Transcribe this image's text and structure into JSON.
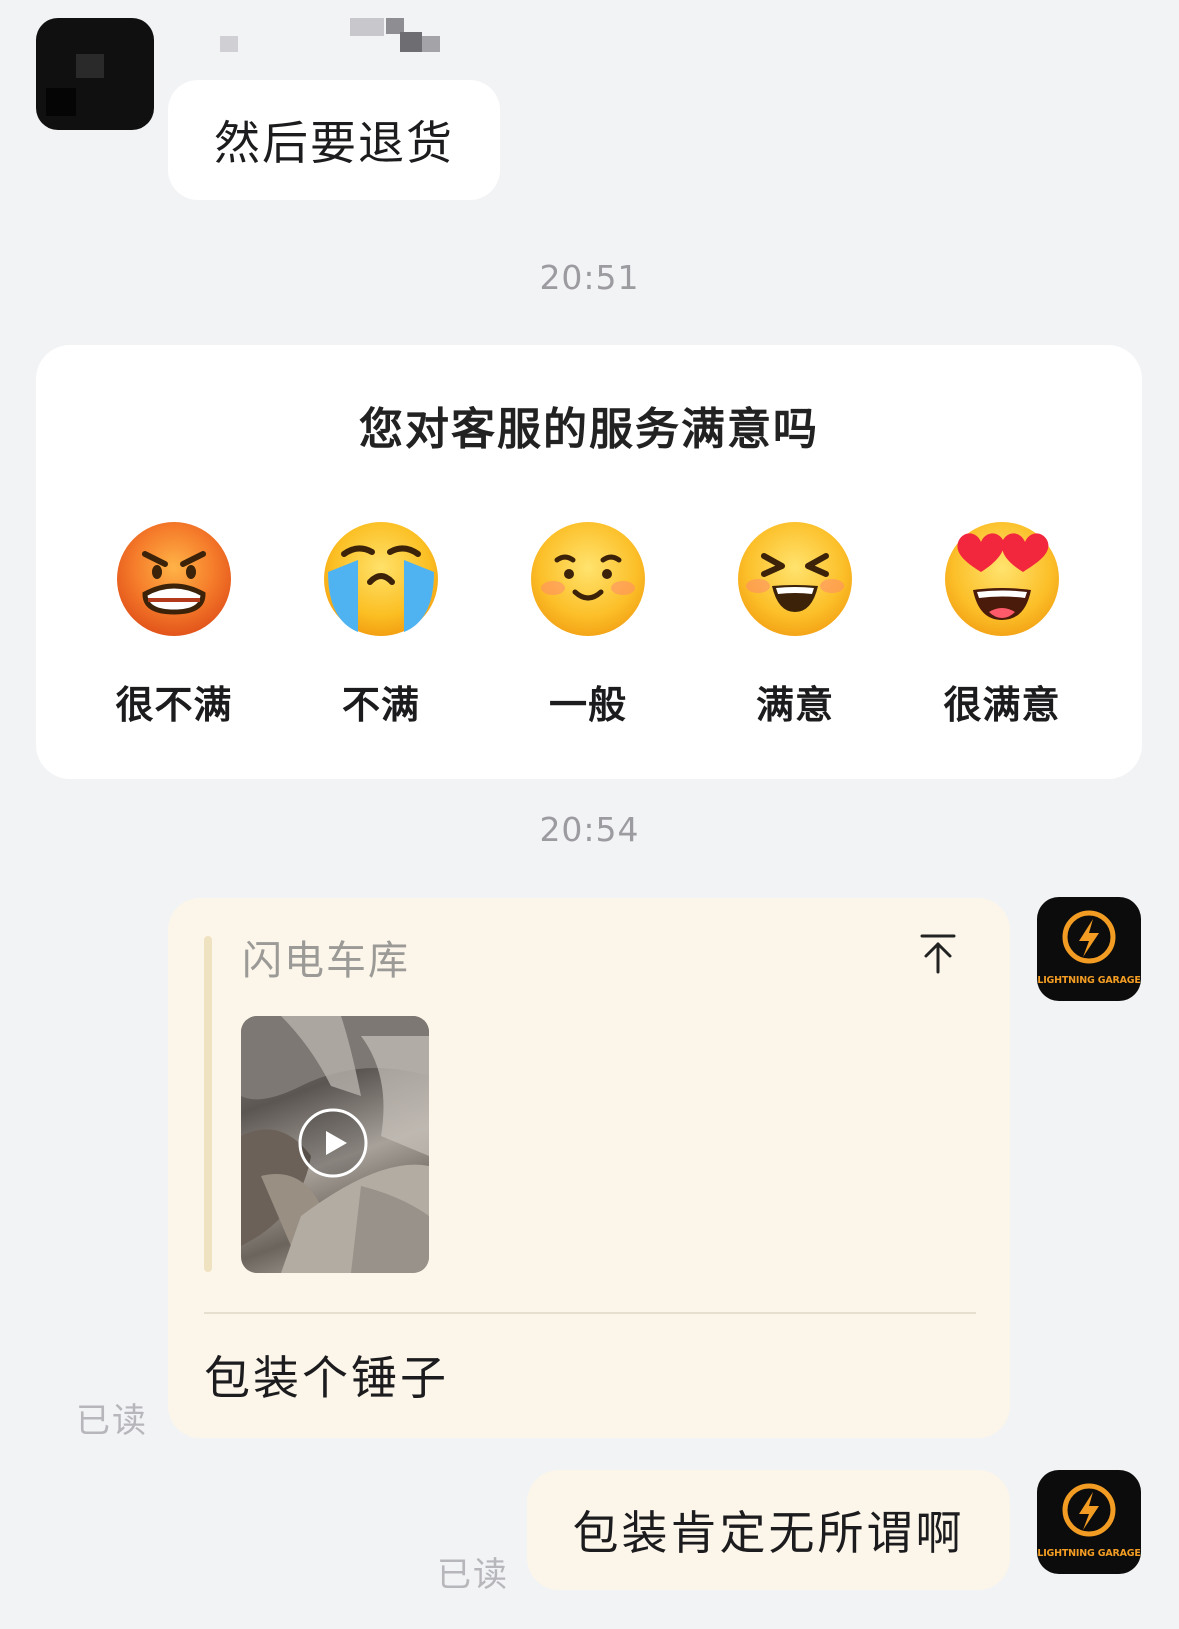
{
  "incoming_message": {
    "text": "然后要退货"
  },
  "timestamps": [
    "20:51",
    "20:54"
  ],
  "satisfaction_survey": {
    "title": "您对客服的服务满意吗",
    "options": [
      {
        "label": "很不满",
        "icon": "angry-face-icon"
      },
      {
        "label": "不满",
        "icon": "crying-face-icon"
      },
      {
        "label": "一般",
        "icon": "neutral-smile-face-icon"
      },
      {
        "label": "满意",
        "icon": "grinning-squint-face-icon"
      },
      {
        "label": "很满意",
        "icon": "heart-eyes-face-icon"
      }
    ]
  },
  "quoted_message": {
    "sender": "闪电车库",
    "attachment": "video",
    "reply_text": "包装个锤子",
    "status": "已读"
  },
  "outgoing_message": {
    "text": "包装肯定无所谓啊",
    "status": "已读"
  },
  "shop_avatar": {
    "brand_text": "LIGHTNING GARAGE",
    "accent_color": "#f29c23"
  },
  "colors": {
    "background": "#f2f3f5",
    "incoming_bubble": "#ffffff",
    "outgoing_bubble": "#fcf6ea"
  }
}
